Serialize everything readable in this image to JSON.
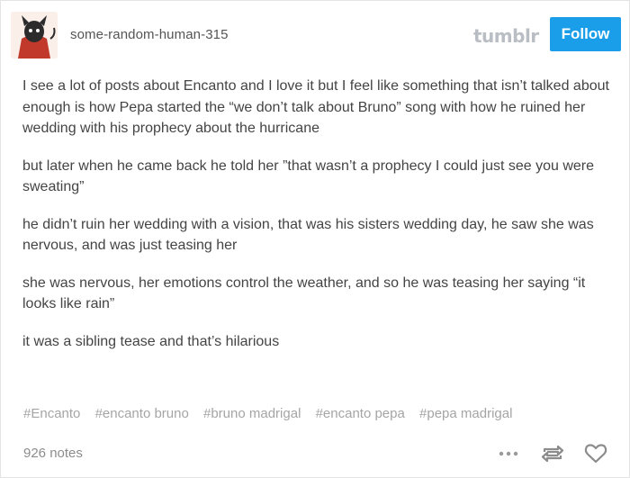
{
  "post": {
    "username": "some-random-human-315",
    "brand": "tumblr",
    "follow_label": "Follow",
    "paragraphs": [
      "I see a lot of posts about Encanto and I love it but I feel like something that isn’t talked about enough is how Pepa started the “we don’t talk about Bruno” song with how he ruined her wedding with his prophecy about the hurricane",
      "but later when he came back he told her ”that wasn’t a prophecy I could just see you were sweating”",
      "he didn’t ruin her wedding with a vision, that was his sisters wedding day, he saw she was nervous, and was just teasing her",
      "she was nervous, her emotions control the weather, and so he was teasing her saying “it looks like rain”",
      "it was a sibling tease and that’s hilarious"
    ],
    "tags": [
      "#Encanto",
      "#encanto bruno",
      "#bruno madrigal",
      "#encanto pepa",
      "#pepa madrigal"
    ],
    "notes": "926 notes"
  },
  "icons": {
    "more": "ellipsis-icon",
    "reblog": "reblog-icon",
    "like": "heart-icon"
  },
  "colors": {
    "follow_bg": "#1b9eea",
    "text": "#444444",
    "tag": "#a5a5a5"
  }
}
